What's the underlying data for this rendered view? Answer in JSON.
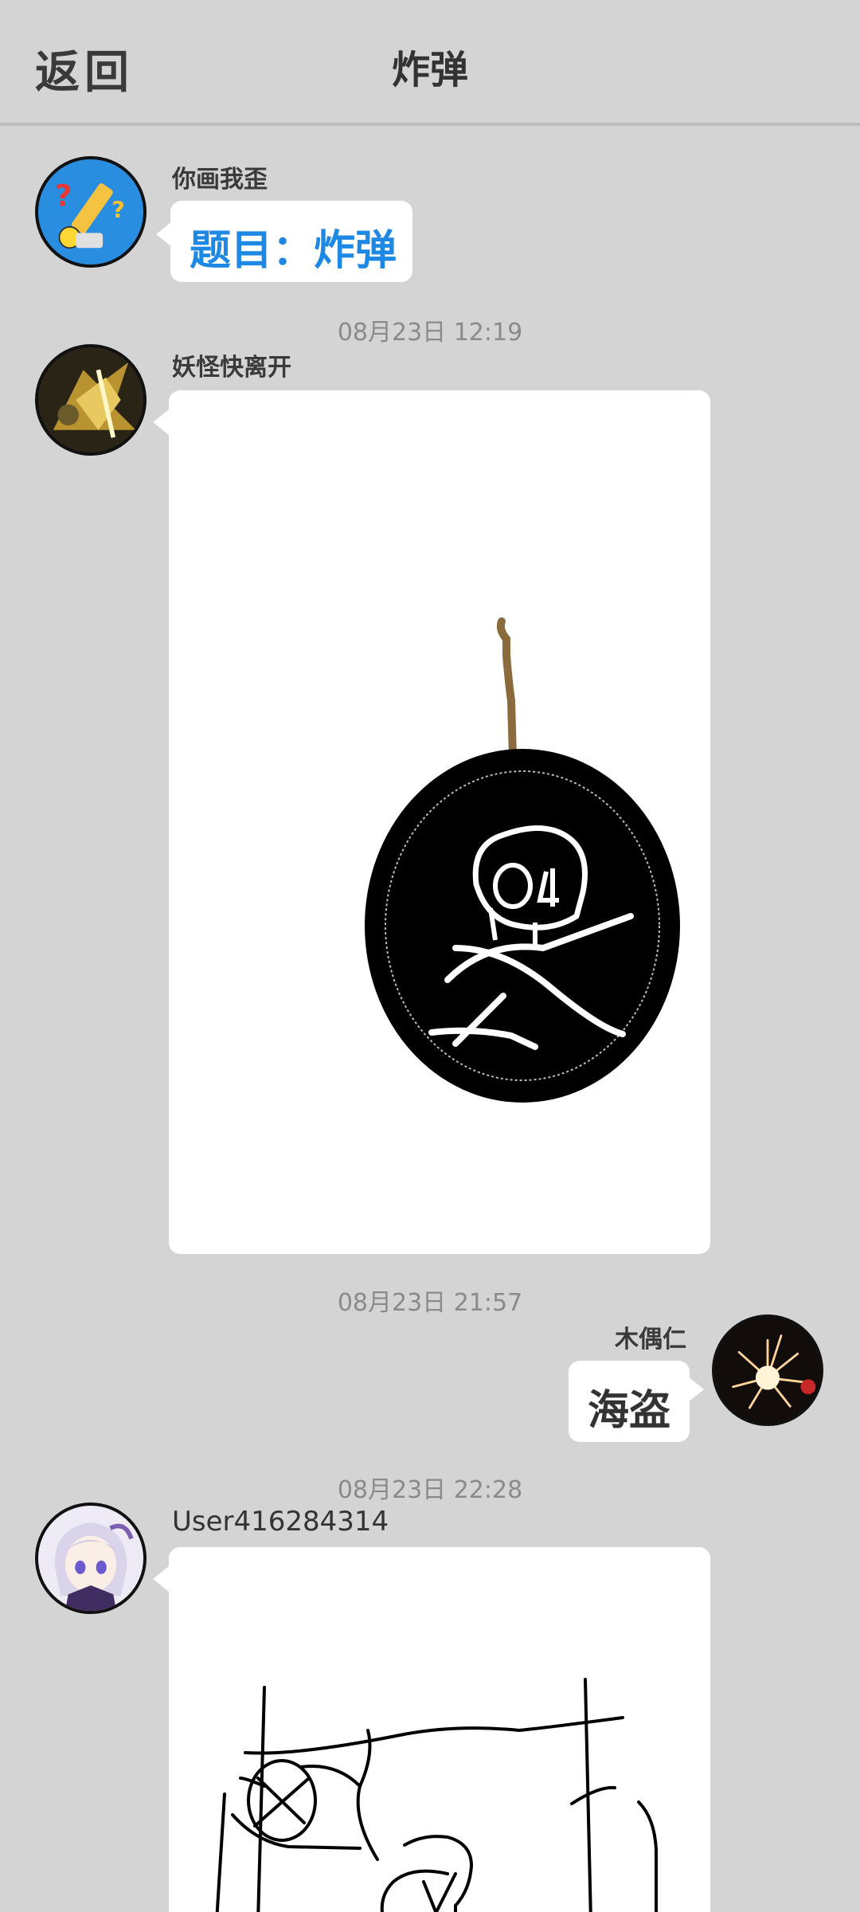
{
  "header": {
    "back_label": "返回",
    "title": "炸弹"
  },
  "messages": [
    {
      "sender": "你画我歪",
      "text": "题目：炸弹",
      "text_color": "#1e88e5",
      "avatar_icon": "pencil-question-icon"
    },
    {
      "timestamp": "08月23日  12:19",
      "sender": "妖怪快离开",
      "content": "drawing",
      "drawing_subject": "bomb-with-skull-drawing",
      "avatar_icon": "golden-character-avatar"
    },
    {
      "timestamp": "08月23日  21:57",
      "sender": "木偶仁",
      "text": "海盗",
      "avatar_icon": "firework-avatar"
    },
    {
      "timestamp": "08月23日  22:28",
      "sender": "User416284314",
      "content": "drawing",
      "drawing_subject": "sketch-drawing",
      "avatar_icon": "anime-girl-avatar"
    }
  ],
  "colors": {
    "background": "#d4d4d4",
    "bubble": "#ffffff",
    "topic_text": "#1e88e5",
    "timestamp": "#8a8a8a"
  }
}
